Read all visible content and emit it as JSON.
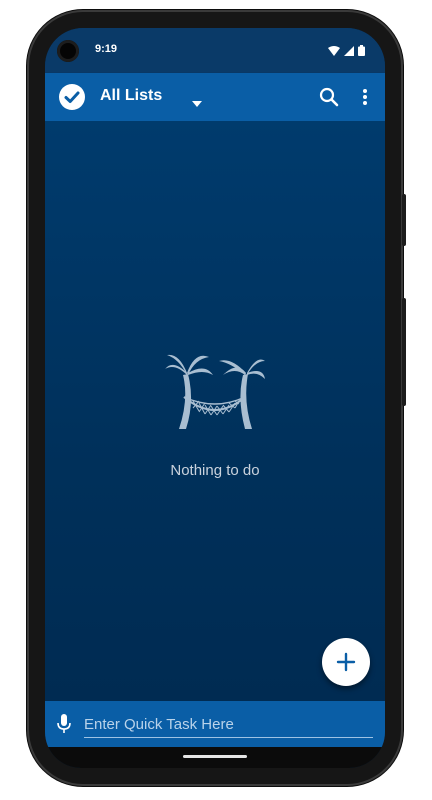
{
  "status_bar": {
    "time": "9:19"
  },
  "app_bar": {
    "title": "All Lists"
  },
  "icons": {
    "check": "check-circle-icon",
    "dropdown": "caret-down-icon",
    "search": "search-icon",
    "more": "more-vert-icon",
    "empty": "palm-trees-hammock-icon",
    "add": "plus-icon",
    "mic": "microphone-icon"
  },
  "empty_state": {
    "message": "Nothing to do"
  },
  "quick_task": {
    "placeholder": "Enter Quick Task Here",
    "value": ""
  },
  "colors": {
    "app_bar": "#0a5ea6",
    "background": "#002b52",
    "accent": "#0a5ea6",
    "fab": "#ffffff"
  }
}
